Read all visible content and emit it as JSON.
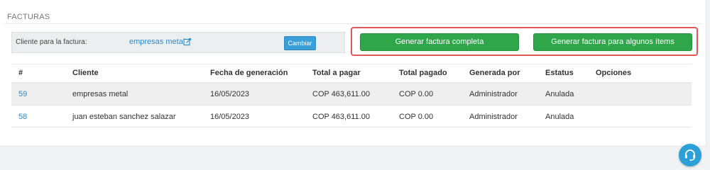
{
  "panel": {
    "title": "FACTURAS"
  },
  "client": {
    "label": "Cliente para la factura:",
    "name": "empresas metal",
    "change_label": "Cambiar"
  },
  "actions": {
    "full_invoice": "Generar factura completa",
    "partial_invoice": "Generar factura para algunos ítems"
  },
  "table": {
    "columns": [
      "#",
      "Cliente",
      "Fecha de generación",
      "Total a pagar",
      "Total pagado",
      "Generada por",
      "Estatus",
      "Opciones"
    ],
    "rows": [
      {
        "id": "59",
        "client": "empresas metal",
        "date": "16/05/2023",
        "total": "COP 463,611.00",
        "paid": "COP 0.00",
        "by": "Administrador",
        "status": "Anulada"
      },
      {
        "id": "58",
        "client": "juan esteban sanchez salazar",
        "date": "16/05/2023",
        "total": "COP 463,611.00",
        "paid": "COP 0.00",
        "by": "Administrador",
        "status": "Anulada"
      }
    ]
  },
  "colors": {
    "primary_blue": "#2a8bc9",
    "green": "#2fa64a",
    "highlight_red": "#e2575a"
  },
  "icons": {
    "edit": "external-edit-icon",
    "help": "headset-support-icon"
  }
}
